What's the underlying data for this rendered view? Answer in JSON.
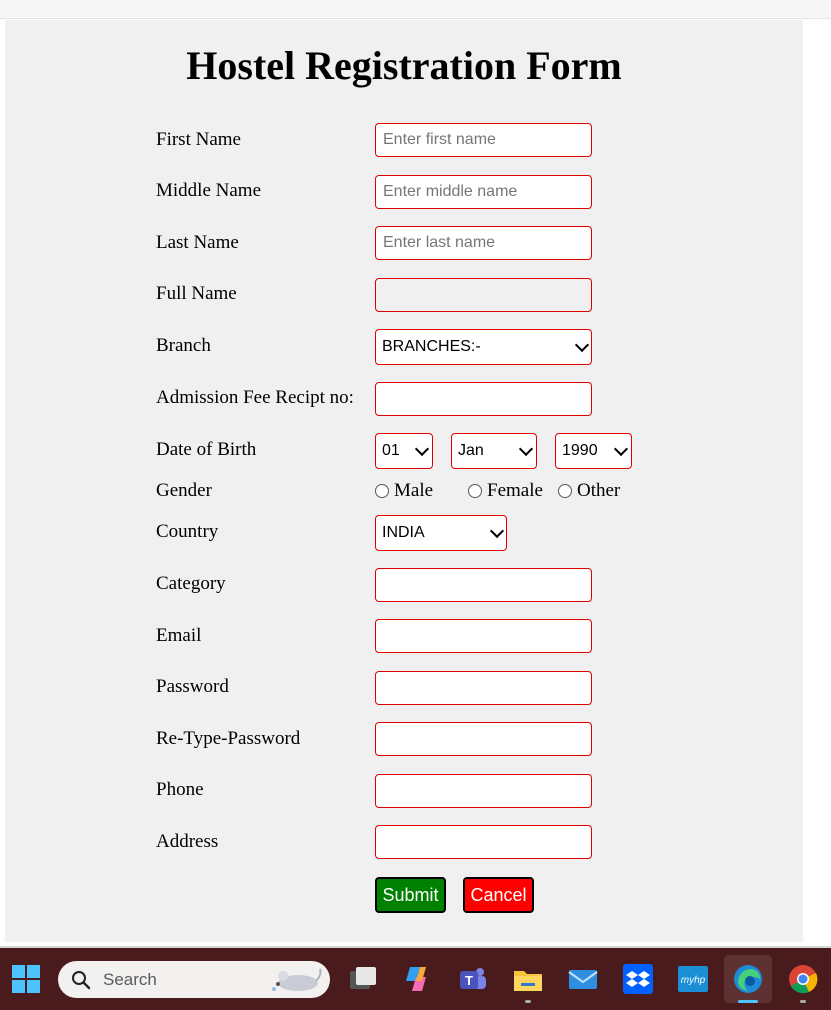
{
  "form": {
    "title": "Hostel Registration Form",
    "fields": [
      {
        "label": "First Name",
        "placeholder": "Enter first name",
        "value": ""
      },
      {
        "label": "Middle Name",
        "placeholder": "Enter middle name",
        "value": ""
      },
      {
        "label": "Last Name",
        "placeholder": "Enter last name",
        "value": ""
      },
      {
        "label": "Full Name",
        "placeholder": "",
        "value": ""
      }
    ],
    "branch": {
      "label": "Branch",
      "selected": "BRANCHES:-"
    },
    "receipt": {
      "label": "Admission Fee Recipt no:",
      "value": ""
    },
    "dob": {
      "label": "Date of Birth",
      "day": "01",
      "month": "Jan",
      "year": "1990"
    },
    "gender": {
      "label": "Gender",
      "options": [
        "Male",
        "Female",
        "Other"
      ]
    },
    "country": {
      "label": "Country",
      "selected": "INDIA"
    },
    "more_fields": [
      {
        "label": "Category",
        "value": ""
      },
      {
        "label": "Email",
        "value": ""
      },
      {
        "label": "Password",
        "value": ""
      },
      {
        "label": "Re-Type-Password",
        "value": ""
      },
      {
        "label": "Phone",
        "value": ""
      },
      {
        "label": "Address",
        "value": ""
      }
    ],
    "buttons": {
      "submit": "Submit",
      "cancel": "Cancel"
    },
    "colors": {
      "border": "#e00000",
      "submit_bg": "#008000",
      "cancel_bg": "#ff0000"
    }
  },
  "taskbar": {
    "search_placeholder": "Search",
    "icons": [
      "windows-start-icon",
      "search-icon",
      "mouse-mascot-icon",
      "task-view-icon",
      "copilot-icon",
      "teams-icon",
      "file-explorer-icon",
      "mail-icon",
      "dropbox-icon",
      "myhp-icon",
      "edge-icon",
      "chrome-icon"
    ],
    "myhp_label": "myhp"
  }
}
